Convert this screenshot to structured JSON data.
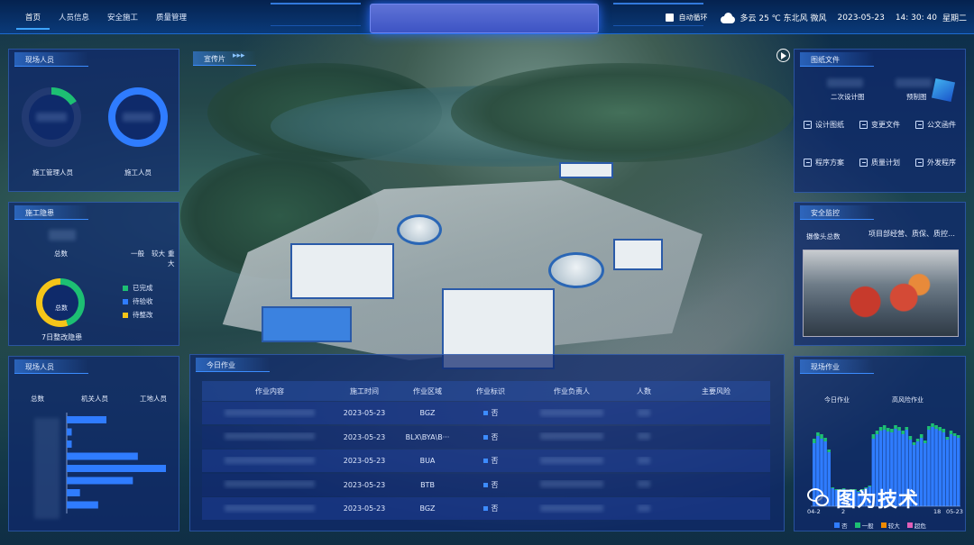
{
  "nav": [
    "首页",
    "人员信息",
    "安全施工",
    "质量管理"
  ],
  "status": {
    "auto_loop": "自动循环",
    "weather": "多云 25 ℃ 东北风 微风",
    "date": "2023-05-23",
    "time": "14: 30: 40",
    "weekday": "星期二"
  },
  "panels": {
    "site_staff": {
      "title": "现场人员",
      "labels": [
        "施工管理人员",
        "施工人员"
      ]
    },
    "hazard": {
      "title": "施工隐患",
      "total_label": "总数",
      "levels": [
        "一般",
        "较大",
        "重大"
      ],
      "donut_center": "总数",
      "legend": [
        "已完成",
        "待验收",
        "待整改"
      ],
      "footer": "7日整改隐患"
    },
    "site_staff2": {
      "title": "现场人员",
      "cols": [
        "总数",
        "机关人员",
        "工地人员"
      ]
    },
    "promo": {
      "title": "宣传片"
    },
    "drawings": {
      "title": "图纸文件",
      "tabs": [
        "二次设计图",
        "预制图"
      ],
      "items": [
        "设计图纸",
        "变更文件",
        "公文函件",
        "程序方案",
        "质量计划",
        "外发程序"
      ]
    },
    "safety": {
      "title": "安全监控",
      "camera_label": "摄像头总数",
      "camera_desc": "项目部经营、质保、质控…"
    },
    "site_work": {
      "title": "现场作业",
      "labels": [
        "今日作业",
        "高风险作业"
      ],
      "xtick_left": "04-2",
      "xtick_mid": "2",
      "xtick_r1": "18",
      "xtick_r2": "05-23",
      "legend": [
        "否",
        "一般",
        "较大",
        "超危"
      ]
    },
    "today_work": {
      "title": "今日作业",
      "headers": [
        "作业内容",
        "施工时间",
        "作业区域",
        "作业标识",
        "作业负责人",
        "人数",
        "主要风险"
      ],
      "rows": [
        {
          "date": "2023-05-23",
          "area": "BGZ",
          "flag": "否"
        },
        {
          "date": "2023-05-23",
          "area": "BLX\\BYA\\B···",
          "flag": "否"
        },
        {
          "date": "2023-05-23",
          "area": "BUA",
          "flag": "否"
        },
        {
          "date": "2023-05-23",
          "area": "BTB",
          "flag": "否"
        },
        {
          "date": "2023-05-23",
          "area": "BGZ",
          "flag": "否"
        }
      ]
    }
  },
  "watermark": "图为技术",
  "colors": {
    "accent": "#3da4ff",
    "green": "#1dbf73",
    "yellow": "#f5c518",
    "blue": "#2f7cff",
    "orange": "#f08a00",
    "pink": "#e05fb8"
  },
  "chart_data": [
    {
      "type": "bar",
      "title": "",
      "orientation": "horizontal",
      "categories": [
        "1",
        "2",
        "3",
        "4",
        "5",
        "6",
        "7",
        "8"
      ],
      "values": [
        24,
        3,
        3,
        43,
        60,
        40,
        8,
        19
      ],
      "xlim": [
        0,
        60
      ]
    },
    {
      "type": "bar",
      "stacked": true,
      "categories": [
        "1",
        "2",
        "3",
        "4",
        "5",
        "6",
        "7",
        "8",
        "9",
        "10",
        "11",
        "12",
        "13",
        "14",
        "15",
        "16",
        "17",
        "18",
        "19",
        "20",
        "21",
        "22",
        "23",
        "24",
        "25",
        "26",
        "27",
        "28",
        "29",
        "30",
        "31",
        "32",
        "33",
        "34",
        "35",
        "36",
        "37",
        "38",
        "39",
        "40"
      ],
      "series": [
        {
          "name": "否",
          "values": [
            70,
            78,
            75,
            72,
            60,
            20,
            18,
            18,
            19,
            17,
            18,
            18,
            16,
            18,
            20,
            22,
            75,
            80,
            84,
            85,
            83,
            82,
            86,
            84,
            80,
            85,
            74,
            68,
            72,
            76,
            70,
            85,
            88,
            86,
            84,
            82,
            74,
            80,
            78,
            76
          ]
        },
        {
          "name": "一般",
          "values": [
            5,
            4,
            5,
            4,
            3,
            1,
            1,
            1,
            1,
            1,
            1,
            1,
            1,
            1,
            1,
            1,
            5,
            4,
            4,
            5,
            4,
            4,
            4,
            4,
            4,
            3,
            4,
            3,
            3,
            4,
            3,
            4,
            4,
            4,
            4,
            4,
            3,
            4,
            3,
            3
          ]
        }
      ],
      "ylim": [
        0,
        100
      ]
    }
  ]
}
